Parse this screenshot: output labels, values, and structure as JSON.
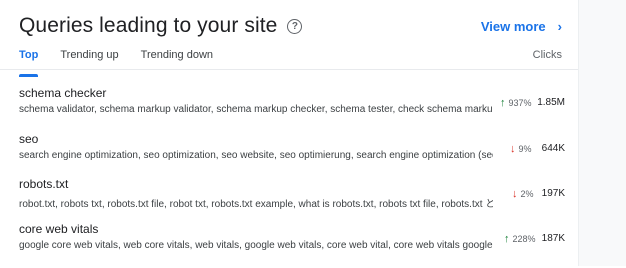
{
  "header": {
    "title": "Queries leading to your site",
    "help_glyph": "?",
    "view_more_label": "View more",
    "view_more_chevron": "›"
  },
  "tabs": [
    {
      "label": "Top",
      "active": true
    },
    {
      "label": "Trending up",
      "active": false
    },
    {
      "label": "Trending down",
      "active": false
    }
  ],
  "columns": {
    "clicks": "Clicks"
  },
  "rows": [
    {
      "query": "schema checker",
      "related": "schema validator, schema markup validator, schema markup checker, schema tester, check schema markup, schem...",
      "direction": "up",
      "arrow": "↑",
      "change": "937%",
      "clicks": "1.85M"
    },
    {
      "query": "seo",
      "related": "search engine optimization, seo optimization, seo website, seo optimierung, search engine optimization (seo), search ...",
      "direction": "down",
      "arrow": "↓",
      "change": "9%",
      "clicks": "644K"
    },
    {
      "query": "robots.txt",
      "related": "robot.txt, robots txt, robots.txt file, robot txt, robots.txt example, what is robots.txt, robots txt file, robots.txt とは, robot...",
      "direction": "down",
      "arrow": "↓",
      "change": "2%",
      "clicks": "197K"
    },
    {
      "query": "core web vitals",
      "related": "google core web vitals, web core vitals, web vitals, google web vitals, core web vital, core web vitals google, coreweb...",
      "direction": "up",
      "arrow": "↑",
      "change": "228%",
      "clicks": "187K"
    }
  ],
  "colors": {
    "accent": "#1a73e8",
    "up": "#188038",
    "down": "#d93025"
  }
}
